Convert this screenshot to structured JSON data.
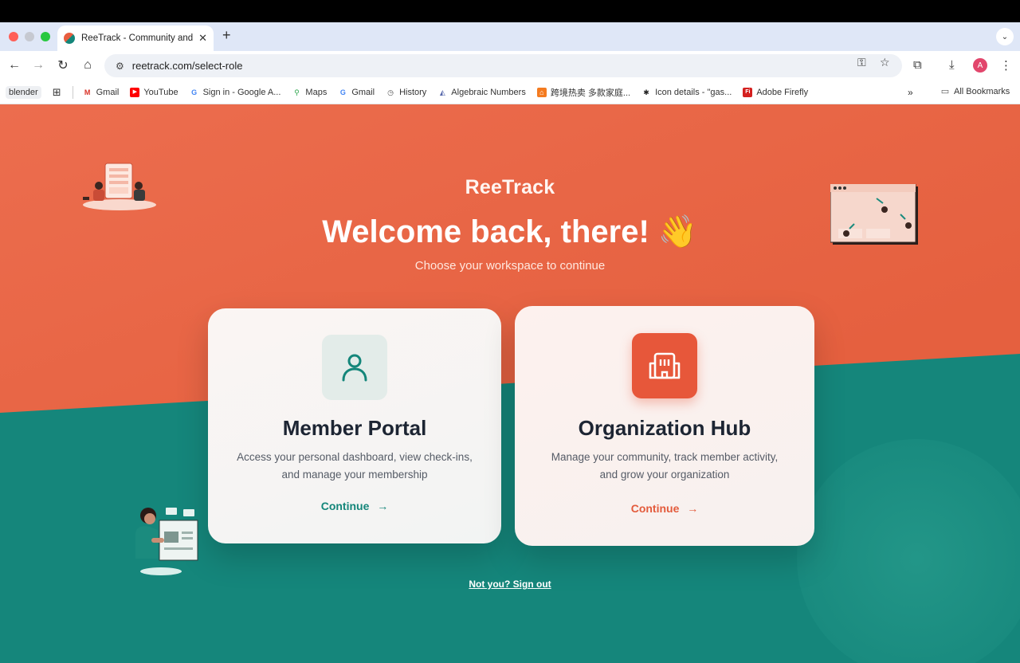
{
  "browser": {
    "tab_title": "ReeTrack - Community and P...",
    "url": "reetrack.com/select-role",
    "avatar_letter": "A"
  },
  "bookmarks": {
    "items": [
      {
        "label": "blender",
        "icon": "none"
      },
      {
        "label": "Gmail",
        "icon": "gmail-icon"
      },
      {
        "label": "YouTube",
        "icon": "youtube-icon"
      },
      {
        "label": "Sign in - Google A...",
        "icon": "google-icon"
      },
      {
        "label": "Maps",
        "icon": "maps-icon"
      },
      {
        "label": "Gmail",
        "icon": "google-icon"
      },
      {
        "label": "History",
        "icon": "history-icon"
      },
      {
        "label": "Algebraic Numbers",
        "icon": "algebra-icon"
      },
      {
        "label": "跨境热卖 多款家庭...",
        "icon": "shop-icon"
      },
      {
        "label": "Icon details - \"gas...",
        "icon": "icon-site-icon"
      },
      {
        "label": "Adobe Firefly",
        "icon": "adobe-icon"
      }
    ],
    "more": "»",
    "all_label": "All Bookmarks"
  },
  "page": {
    "brand": "ReeTrack",
    "welcome": "Welcome back, there! 👋",
    "subtitle": "Choose your workspace to continue",
    "member": {
      "title": "Member Portal",
      "desc_line1": "Access your personal dashboard, view check-ins,",
      "desc_line2": "and manage your membership",
      "cta": "Continue"
    },
    "org": {
      "title": "Organization Hub",
      "desc_line1": "Manage your community, track member activity,",
      "desc_line2": "and grow your organization",
      "cta": "Continue"
    },
    "signout": "Not you? Sign out"
  },
  "colors": {
    "brand_orange": "#e5603f",
    "brand_teal": "#15867b"
  }
}
